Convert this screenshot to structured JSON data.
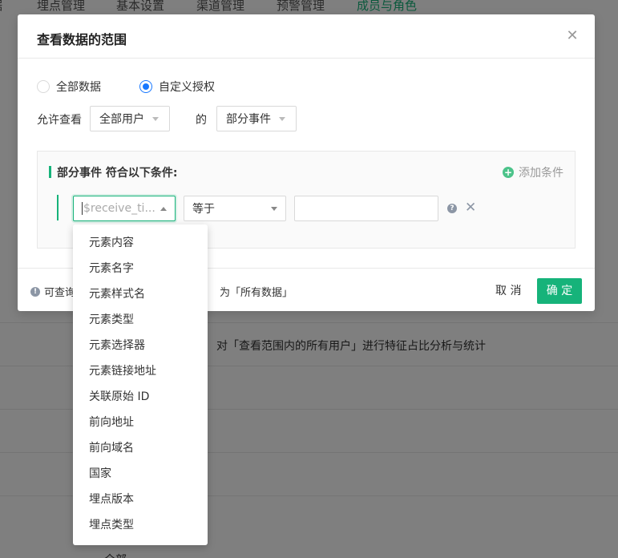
{
  "background": {
    "nav": [
      "据",
      "埋点管理",
      "基本设置",
      "渠道管理",
      "预警管理",
      "成员与角色"
    ],
    "row_text": "对「查看范围内的所有用户」进行特征占比分析与统计",
    "bottom_text": "全部"
  },
  "modal": {
    "title": "查看数据的范围",
    "radio_all": "全部数据",
    "radio_custom": "自定义授权",
    "allow_label": "允许查看",
    "user_select": "全部用户",
    "de": "的",
    "event_select": "部分事件",
    "condition_title": "部分事件 符合以下条件:",
    "add_condition": "添加条件",
    "field_placeholder": "$receive_ti...",
    "operator": "等于",
    "value": "",
    "footer_prefix": "可查询",
    "footer_suffix": "为「所有数据」",
    "cancel": "取 消",
    "ok": "确 定"
  },
  "dropdown": {
    "items": [
      "元素内容",
      "元素名字",
      "元素样式名",
      "元素类型",
      "元素选择器",
      "元素链接地址",
      "关联原始 ID",
      "前向地址",
      "前向域名",
      "国家",
      "埋点版本",
      "埋点类型"
    ]
  },
  "colors": {
    "accent": "#16b37a",
    "radio": "#1677ff"
  }
}
